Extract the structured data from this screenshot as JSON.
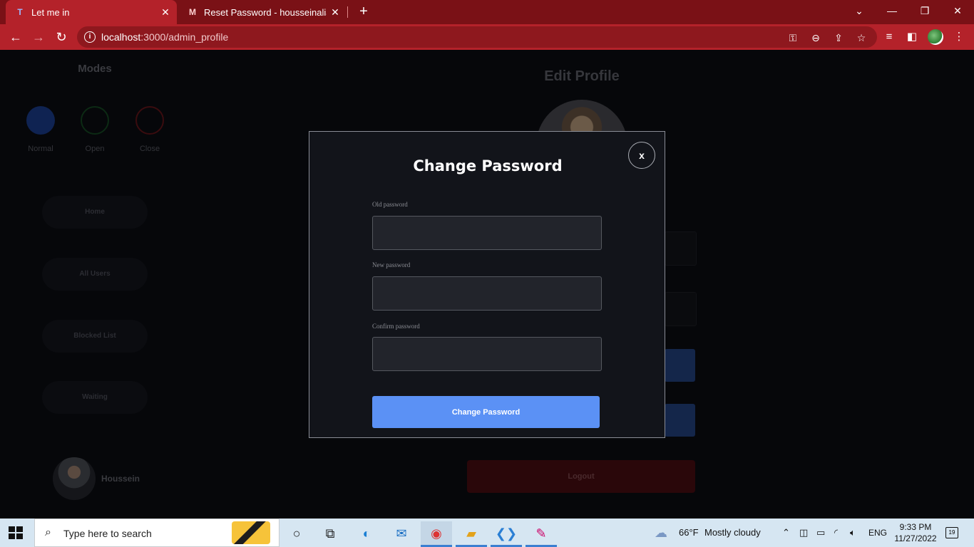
{
  "browser": {
    "tabs": [
      {
        "title": "Let me in",
        "favicon": "T"
      },
      {
        "title": "Reset Password - housseinalialdr",
        "favicon": "M"
      }
    ],
    "url_host": "localhost",
    "url_path": ":3000/admin_profile",
    "accent": "#b4222a"
  },
  "sidebar": {
    "title": "Modes",
    "modes": [
      {
        "label": "Normal",
        "color": "#0f2352"
      },
      {
        "label": "Open",
        "color": "#0c2a14"
      },
      {
        "label": "Close",
        "color": "#3a0c0f"
      }
    ],
    "nav": [
      "Home",
      "All Users",
      "Blocked List",
      "Waiting"
    ],
    "user_name": "Houssein"
  },
  "profile": {
    "title": "Edit Profile",
    "logout_label": "Logout"
  },
  "modal": {
    "title": "Change Password",
    "close_label": "x",
    "fields": [
      {
        "label": "Old password",
        "value": ""
      },
      {
        "label": "New password",
        "value": ""
      },
      {
        "label": "Confirm password",
        "value": ""
      }
    ],
    "submit_label": "Change Password",
    "submit_color": "#5b91f5"
  },
  "taskbar": {
    "search_placeholder": "Type here to search",
    "weather_temp": "66°F",
    "weather_text": "Mostly cloudy",
    "language": "ENG",
    "time": "9:33 PM",
    "date": "11/27/2022",
    "notification_count": "19"
  }
}
